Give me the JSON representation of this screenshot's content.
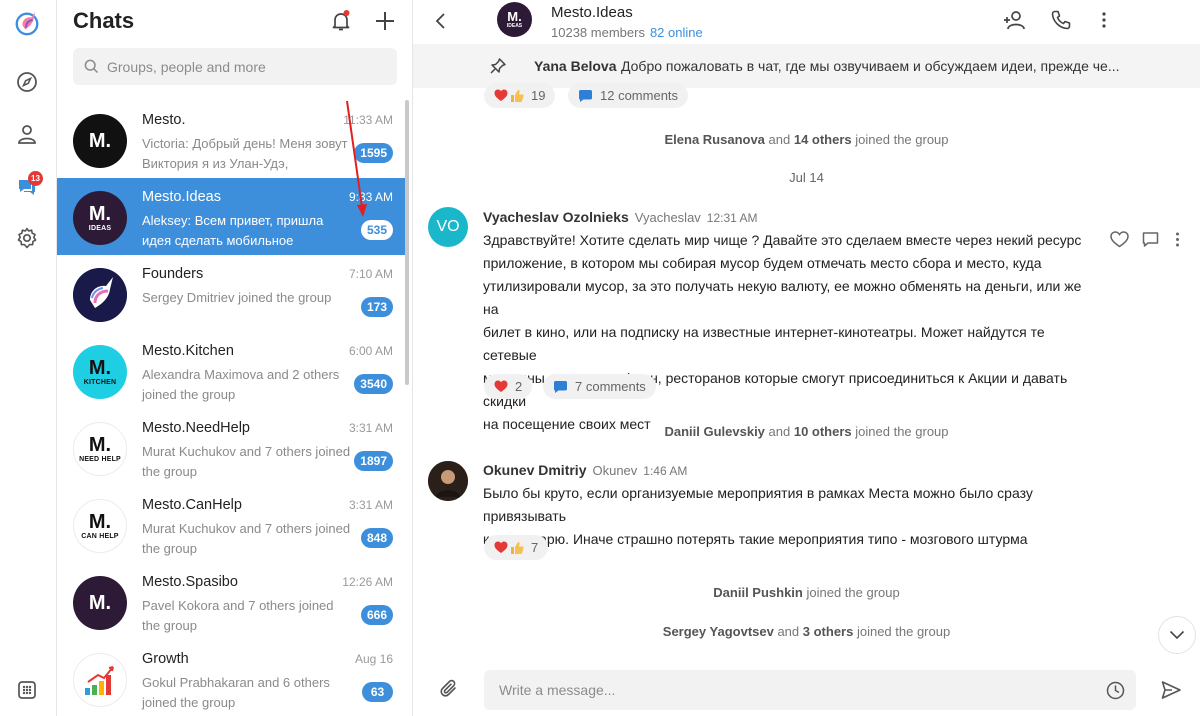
{
  "sidebar": {
    "messages_badge": "13"
  },
  "chat_list": {
    "title": "Chats",
    "search_placeholder": "Groups, people and more",
    "chats": [
      {
        "name": "Mesto.",
        "preview": "Victoria: Добрый день! Меня зовут Виктория я из Улан-Удэ,",
        "time": "11:33 AM",
        "unread": "1595",
        "avatar_text": "M.",
        "avatar_sub": ""
      },
      {
        "name": "Mesto.Ideas",
        "preview": "Aleksey: Всем привет, пришла идея сделать мобильное",
        "time": "9:33 AM",
        "unread": "535",
        "avatar_text": "M.",
        "avatar_sub": "IDEAS"
      },
      {
        "name": "Founders",
        "preview": "Sergey Dmitriev joined the group",
        "time": "7:10 AM",
        "unread": "173",
        "avatar_text": "",
        "avatar_sub": ""
      },
      {
        "name": "Mesto.Kitchen",
        "preview": "Alexandra Maximova and 2 others joined the group",
        "time": "6:00 AM",
        "unread": "3540",
        "avatar_text": "M.",
        "avatar_sub": "KITCHEN"
      },
      {
        "name": "Mesto.NeedHelp",
        "preview": "Murat Kuchukov and 7 others joined the group",
        "time": "3:31 AM",
        "unread": "1897",
        "avatar_text": "M.",
        "avatar_sub": "NEED HELP"
      },
      {
        "name": "Mesto.CanHelp",
        "preview": "Murat Kuchukov and 7 others joined the group",
        "time": "3:31 AM",
        "unread": "848",
        "avatar_text": "M.",
        "avatar_sub": "CAN HELP"
      },
      {
        "name": "Mesto.Spasibo",
        "preview": "Pavel Kokora and 7 others joined the group",
        "time": "12:26 AM",
        "unread": "666",
        "avatar_text": "M.",
        "avatar_sub": ""
      },
      {
        "name": "Growth",
        "preview": "Gokul Prabhakaran and 6 others joined the group",
        "time": "Aug 16",
        "unread": "63",
        "avatar_text": "",
        "avatar_sub": ""
      }
    ]
  },
  "conversation": {
    "title": "Mesto.Ideas",
    "members": "10238 members",
    "online": "82 online",
    "avatar_text": "M.",
    "avatar_sub": "IDEAS",
    "pinned": {
      "author": "Yana Belova",
      "text": "Добро пожаловать в чат, где мы озвучиваем и обсуждаем идеи, прежде че..."
    },
    "top_reactions": {
      "count": "19",
      "comments": "12 comments"
    },
    "system_1": {
      "name": "Elena Rusanova",
      "mid": " and ",
      "others": "14 others",
      "tail": " joined the group"
    },
    "date_separator": "Jul 14",
    "message_1": {
      "avatar_initials": "VO",
      "author": "Vyacheslav Ozolnieks",
      "username": "Vyacheslav",
      "time": "12:31 AM",
      "lines": [
        "Здравствуйте! Хотите сделать мир чище ? Давайте это сделаем вместе через некий ресурс",
        "приложение, в котором мы собирая мусор будем отмечать место сбора и место, куда",
        "утилизировали мусор, за это получать некую валюту, ее можно обменять на деньги, или же на",
        "билет в кино,  или на подписку на известные интернет-кинотеатры. Может найдутся те сетевые",
        "магазины или сети кофеен, ресторанов которые смогут присоединиться к Акции и давать скидки",
        "на посещение своих мест"
      ],
      "reactions": "2",
      "comments": "7 comments"
    },
    "system_2": {
      "name": "Daniil Gulevskiy",
      "mid": " and ",
      "others": "10 others",
      "tail": " joined the group"
    },
    "message_2": {
      "author": "Okunev Dmitriy",
      "username": "Okunev",
      "time": "1:46 AM",
      "lines": [
        "Было бы круто, если организуемые мероприятия в рамках Места можно было сразу привязывать",
        "к календарю. Иначе страшно потерять такие мероприятия типо - мозгового штурма"
      ],
      "reactions": "7"
    },
    "system_3": {
      "name": "Daniil Pushkin",
      "tail": " joined the group"
    },
    "system_4": {
      "name": "Sergey Yagovtsev",
      "mid": " and ",
      "others": "3 others",
      "tail": " joined the group"
    },
    "composer_placeholder": "Write a message..."
  },
  "colors": {
    "accent": "#3d8fdb",
    "badge_red": "#e53935",
    "heart": "#e53935",
    "annotation_arrow": "#e02020"
  },
  "icons": [
    "unicorn-logo",
    "compass-icon",
    "person-icon",
    "messages-icon",
    "gear-icon",
    "apps-grid-icon",
    "bell-icon",
    "plus-icon",
    "search-icon",
    "back-icon",
    "add-user-icon",
    "phone-icon",
    "more-icon",
    "pin-icon",
    "heart-icon",
    "thumbs-up-icon",
    "comment-icon",
    "chevron-down-icon",
    "paperclip-icon",
    "emoji-icon",
    "send-icon"
  ]
}
